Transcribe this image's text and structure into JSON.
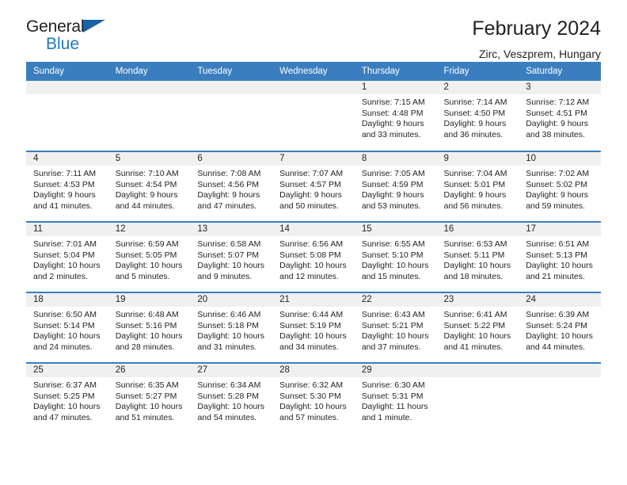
{
  "logo": {
    "word_top": "General",
    "word_bottom": "Blue",
    "triangle_color": "#1763a8",
    "blue": "#1f7ac4"
  },
  "header": {
    "title": "February 2024",
    "subtitle": "Zirc, Veszprem, Hungary"
  },
  "theme": {
    "header_bg": "#3a7ebf",
    "daynum_bg": "#f0f0f0",
    "text": "#231f20"
  },
  "weekdays": [
    "Sunday",
    "Monday",
    "Tuesday",
    "Wednesday",
    "Thursday",
    "Friday",
    "Saturday"
  ],
  "weeks": [
    [
      {
        "day": "",
        "sunrise": "",
        "sunset": "",
        "daylight1": "",
        "daylight2": ""
      },
      {
        "day": "",
        "sunrise": "",
        "sunset": "",
        "daylight1": "",
        "daylight2": ""
      },
      {
        "day": "",
        "sunrise": "",
        "sunset": "",
        "daylight1": "",
        "daylight2": ""
      },
      {
        "day": "",
        "sunrise": "",
        "sunset": "",
        "daylight1": "",
        "daylight2": ""
      },
      {
        "day": "1",
        "sunrise": "Sunrise: 7:15 AM",
        "sunset": "Sunset: 4:48 PM",
        "daylight1": "Daylight: 9 hours",
        "daylight2": "and 33 minutes."
      },
      {
        "day": "2",
        "sunrise": "Sunrise: 7:14 AM",
        "sunset": "Sunset: 4:50 PM",
        "daylight1": "Daylight: 9 hours",
        "daylight2": "and 36 minutes."
      },
      {
        "day": "3",
        "sunrise": "Sunrise: 7:12 AM",
        "sunset": "Sunset: 4:51 PM",
        "daylight1": "Daylight: 9 hours",
        "daylight2": "and 38 minutes."
      }
    ],
    [
      {
        "day": "4",
        "sunrise": "Sunrise: 7:11 AM",
        "sunset": "Sunset: 4:53 PM",
        "daylight1": "Daylight: 9 hours",
        "daylight2": "and 41 minutes."
      },
      {
        "day": "5",
        "sunrise": "Sunrise: 7:10 AM",
        "sunset": "Sunset: 4:54 PM",
        "daylight1": "Daylight: 9 hours",
        "daylight2": "and 44 minutes."
      },
      {
        "day": "6",
        "sunrise": "Sunrise: 7:08 AM",
        "sunset": "Sunset: 4:56 PM",
        "daylight1": "Daylight: 9 hours",
        "daylight2": "and 47 minutes."
      },
      {
        "day": "7",
        "sunrise": "Sunrise: 7:07 AM",
        "sunset": "Sunset: 4:57 PM",
        "daylight1": "Daylight: 9 hours",
        "daylight2": "and 50 minutes."
      },
      {
        "day": "8",
        "sunrise": "Sunrise: 7:05 AM",
        "sunset": "Sunset: 4:59 PM",
        "daylight1": "Daylight: 9 hours",
        "daylight2": "and 53 minutes."
      },
      {
        "day": "9",
        "sunrise": "Sunrise: 7:04 AM",
        "sunset": "Sunset: 5:01 PM",
        "daylight1": "Daylight: 9 hours",
        "daylight2": "and 56 minutes."
      },
      {
        "day": "10",
        "sunrise": "Sunrise: 7:02 AM",
        "sunset": "Sunset: 5:02 PM",
        "daylight1": "Daylight: 9 hours",
        "daylight2": "and 59 minutes."
      }
    ],
    [
      {
        "day": "11",
        "sunrise": "Sunrise: 7:01 AM",
        "sunset": "Sunset: 5:04 PM",
        "daylight1": "Daylight: 10 hours",
        "daylight2": "and 2 minutes."
      },
      {
        "day": "12",
        "sunrise": "Sunrise: 6:59 AM",
        "sunset": "Sunset: 5:05 PM",
        "daylight1": "Daylight: 10 hours",
        "daylight2": "and 5 minutes."
      },
      {
        "day": "13",
        "sunrise": "Sunrise: 6:58 AM",
        "sunset": "Sunset: 5:07 PM",
        "daylight1": "Daylight: 10 hours",
        "daylight2": "and 9 minutes."
      },
      {
        "day": "14",
        "sunrise": "Sunrise: 6:56 AM",
        "sunset": "Sunset: 5:08 PM",
        "daylight1": "Daylight: 10 hours",
        "daylight2": "and 12 minutes."
      },
      {
        "day": "15",
        "sunrise": "Sunrise: 6:55 AM",
        "sunset": "Sunset: 5:10 PM",
        "daylight1": "Daylight: 10 hours",
        "daylight2": "and 15 minutes."
      },
      {
        "day": "16",
        "sunrise": "Sunrise: 6:53 AM",
        "sunset": "Sunset: 5:11 PM",
        "daylight1": "Daylight: 10 hours",
        "daylight2": "and 18 minutes."
      },
      {
        "day": "17",
        "sunrise": "Sunrise: 6:51 AM",
        "sunset": "Sunset: 5:13 PM",
        "daylight1": "Daylight: 10 hours",
        "daylight2": "and 21 minutes."
      }
    ],
    [
      {
        "day": "18",
        "sunrise": "Sunrise: 6:50 AM",
        "sunset": "Sunset: 5:14 PM",
        "daylight1": "Daylight: 10 hours",
        "daylight2": "and 24 minutes."
      },
      {
        "day": "19",
        "sunrise": "Sunrise: 6:48 AM",
        "sunset": "Sunset: 5:16 PM",
        "daylight1": "Daylight: 10 hours",
        "daylight2": "and 28 minutes."
      },
      {
        "day": "20",
        "sunrise": "Sunrise: 6:46 AM",
        "sunset": "Sunset: 5:18 PM",
        "daylight1": "Daylight: 10 hours",
        "daylight2": "and 31 minutes."
      },
      {
        "day": "21",
        "sunrise": "Sunrise: 6:44 AM",
        "sunset": "Sunset: 5:19 PM",
        "daylight1": "Daylight: 10 hours",
        "daylight2": "and 34 minutes."
      },
      {
        "day": "22",
        "sunrise": "Sunrise: 6:43 AM",
        "sunset": "Sunset: 5:21 PM",
        "daylight1": "Daylight: 10 hours",
        "daylight2": "and 37 minutes."
      },
      {
        "day": "23",
        "sunrise": "Sunrise: 6:41 AM",
        "sunset": "Sunset: 5:22 PM",
        "daylight1": "Daylight: 10 hours",
        "daylight2": "and 41 minutes."
      },
      {
        "day": "24",
        "sunrise": "Sunrise: 6:39 AM",
        "sunset": "Sunset: 5:24 PM",
        "daylight1": "Daylight: 10 hours",
        "daylight2": "and 44 minutes."
      }
    ],
    [
      {
        "day": "25",
        "sunrise": "Sunrise: 6:37 AM",
        "sunset": "Sunset: 5:25 PM",
        "daylight1": "Daylight: 10 hours",
        "daylight2": "and 47 minutes."
      },
      {
        "day": "26",
        "sunrise": "Sunrise: 6:35 AM",
        "sunset": "Sunset: 5:27 PM",
        "daylight1": "Daylight: 10 hours",
        "daylight2": "and 51 minutes."
      },
      {
        "day": "27",
        "sunrise": "Sunrise: 6:34 AM",
        "sunset": "Sunset: 5:28 PM",
        "daylight1": "Daylight: 10 hours",
        "daylight2": "and 54 minutes."
      },
      {
        "day": "28",
        "sunrise": "Sunrise: 6:32 AM",
        "sunset": "Sunset: 5:30 PM",
        "daylight1": "Daylight: 10 hours",
        "daylight2": "and 57 minutes."
      },
      {
        "day": "29",
        "sunrise": "Sunrise: 6:30 AM",
        "sunset": "Sunset: 5:31 PM",
        "daylight1": "Daylight: 11 hours",
        "daylight2": "and 1 minute."
      },
      {
        "day": "",
        "sunrise": "",
        "sunset": "",
        "daylight1": "",
        "daylight2": ""
      },
      {
        "day": "",
        "sunrise": "",
        "sunset": "",
        "daylight1": "",
        "daylight2": ""
      }
    ]
  ]
}
